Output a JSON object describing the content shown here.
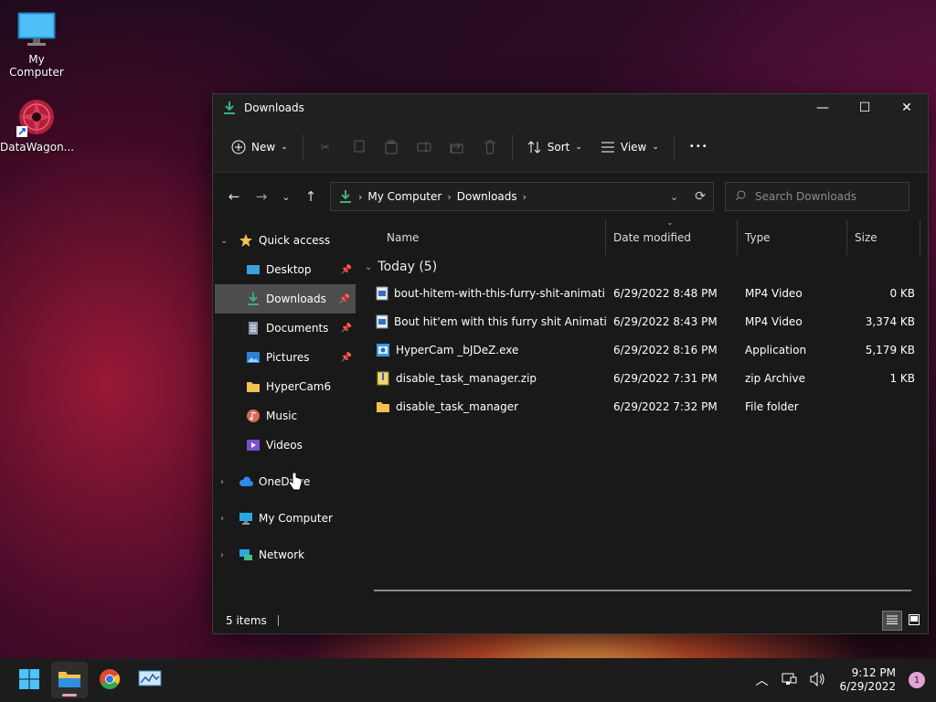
{
  "desktop": {
    "icons": [
      {
        "label": "My Computer"
      },
      {
        "label": "DataWagon..."
      }
    ]
  },
  "window": {
    "title": "Downloads",
    "controls": {
      "minimize": "—",
      "maximize": "☐",
      "close": "✕"
    }
  },
  "toolbar": {
    "new_label": "New",
    "sort_label": "Sort",
    "view_label": "View",
    "more_label": "•••"
  },
  "address": {
    "crumbs": [
      "My Computer",
      "Downloads"
    ],
    "search_placeholder": "Search Downloads"
  },
  "sidebar": {
    "quick_access": "Quick access",
    "items": [
      {
        "label": "Desktop",
        "pinned": true
      },
      {
        "label": "Downloads",
        "pinned": true
      },
      {
        "label": "Documents",
        "pinned": true
      },
      {
        "label": "Pictures",
        "pinned": true
      },
      {
        "label": "HyperCam6",
        "pinned": false
      },
      {
        "label": "Music",
        "pinned": false
      },
      {
        "label": "Videos",
        "pinned": false
      }
    ],
    "roots": [
      {
        "label": "OneDrive"
      },
      {
        "label": "My Computer"
      },
      {
        "label": "Network"
      }
    ]
  },
  "columns": {
    "name": "Name",
    "date": "Date modified",
    "type": "Type",
    "size": "Size"
  },
  "group_label": "Today (5)",
  "files": [
    {
      "name": "bout-hitem-with-this-furry-shit-animati...",
      "date": "6/29/2022 8:48 PM",
      "type": "MP4 Video",
      "size": "0 KB",
      "icon": "video-file-icon"
    },
    {
      "name": "Bout hit'em with this furry shit Animatio...",
      "date": "6/29/2022 8:43 PM",
      "type": "MP4 Video",
      "size": "3,374 KB",
      "icon": "video-file-icon"
    },
    {
      "name": "HyperCam _bJDeZ.exe",
      "date": "6/29/2022 8:16 PM",
      "type": "Application",
      "size": "5,179 KB",
      "icon": "application-icon"
    },
    {
      "name": "disable_task_manager.zip",
      "date": "6/29/2022 7:31 PM",
      "type": "zip Archive",
      "size": "1 KB",
      "icon": "zip-file-icon"
    },
    {
      "name": "disable_task_manager",
      "date": "6/29/2022 7:32 PM",
      "type": "File folder",
      "size": "",
      "icon": "folder-icon"
    }
  ],
  "status": {
    "items_count": "5 items"
  },
  "taskbar": {
    "time": "9:12 PM",
    "date": "6/29/2022",
    "notifications": "1"
  },
  "colors": {
    "accent": "#3bb07a",
    "folder": "#f2c14e",
    "selection": "#4d4d4d"
  }
}
